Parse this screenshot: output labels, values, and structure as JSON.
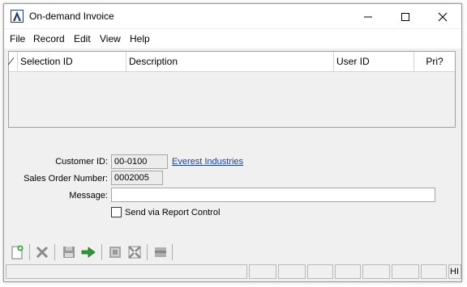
{
  "window": {
    "title": "On-demand Invoice",
    "controls": {
      "minimize": "—",
      "maximize": "☐",
      "close": "✕"
    }
  },
  "menu": [
    "File",
    "Record",
    "Edit",
    "View",
    "Help"
  ],
  "grid": {
    "columns": [
      "⁄",
      "Selection ID",
      "Description",
      "User ID",
      "Pri?"
    ],
    "rows": []
  },
  "form": {
    "customer_id_label": "Customer ID:",
    "customer_id": "00-0100",
    "customer_name": "Everest Industries",
    "sales_order_label": "Sales Order Number:",
    "sales_order": "0002005",
    "message_label": "Message:",
    "message": "",
    "send_label": "Send via Report Control",
    "send_checked": false
  },
  "toolbar": {
    "items": [
      "new-record-icon",
      "delete-icon",
      "save-icon",
      "process-arrow-icon",
      "print-preview-icon",
      "expand-icon",
      "print-icon"
    ]
  },
  "status": {
    "last_panel": "HI"
  },
  "colors": {
    "link": "#1a3ea8",
    "accent": "#1f3b73",
    "arrow": "#2f9a35"
  }
}
